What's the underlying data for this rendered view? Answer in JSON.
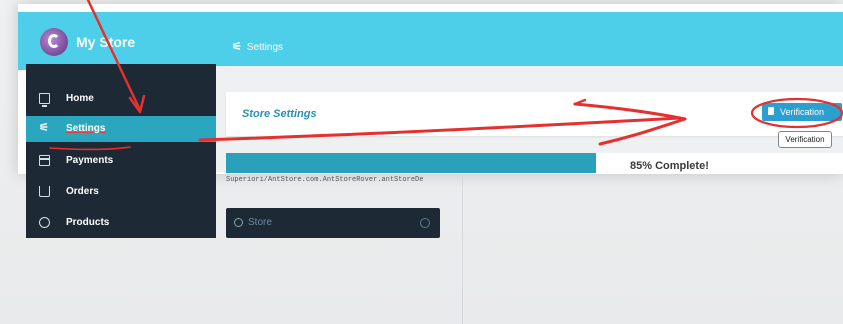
{
  "header": {
    "brand": "My Store",
    "breadcrumb_icon": "⚟",
    "breadcrumb": "Settings"
  },
  "sidebar": {
    "items": [
      {
        "label": "Home",
        "icon": "monitor-icon"
      },
      {
        "label": "Settings",
        "icon": "settings-icon",
        "active": true
      },
      {
        "label": "Payments",
        "icon": "card-icon"
      },
      {
        "label": "Orders",
        "icon": "cart-icon"
      },
      {
        "label": "Products",
        "icon": "products-icon"
      }
    ]
  },
  "main": {
    "card_title": "Store Settings",
    "verify_button": "Verification",
    "tooltip": "Verification",
    "progress": {
      "value_percent": 85,
      "label": "85% Complete!"
    },
    "url_text": "Superiori/AntStore.com.AntStoreRover.antStoreDe",
    "dark_bar_text": "Store"
  },
  "colors": {
    "topbar": "#4dcfe9",
    "sidebar": "#1d2a36",
    "active": "#2aa7be",
    "annotation": "#e53030"
  }
}
